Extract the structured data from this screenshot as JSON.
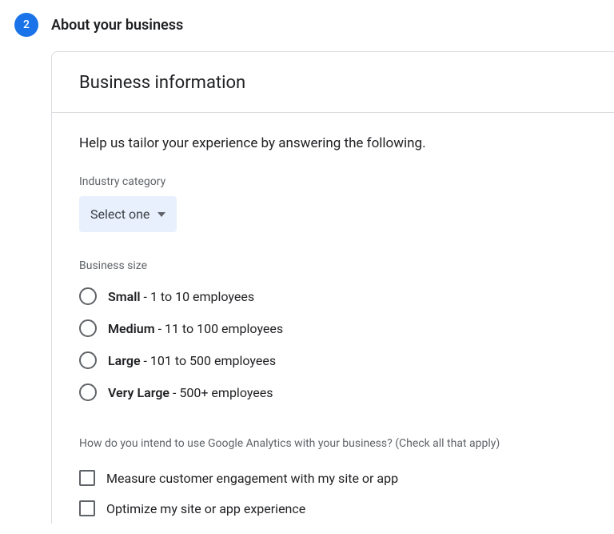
{
  "step": {
    "number": "2",
    "title": "About your business"
  },
  "card": {
    "title": "Business information",
    "helpText": "Help us tailor your experience by answering the following."
  },
  "industry": {
    "label": "Industry category",
    "selected": "Select one"
  },
  "businessSize": {
    "label": "Business size",
    "options": [
      {
        "bold": "Small",
        "rest": " - 1 to 10 employees"
      },
      {
        "bold": "Medium",
        "rest": " - 11 to 100 employees"
      },
      {
        "bold": "Large",
        "rest": " - 101 to 500 employees"
      },
      {
        "bold": "Very Large",
        "rest": " - 500+ employees"
      }
    ]
  },
  "usage": {
    "question": "How do you intend to use Google Analytics with your business? (Check all that apply)",
    "options": [
      "Measure customer engagement with my site or app",
      "Optimize my site or app experience"
    ]
  }
}
